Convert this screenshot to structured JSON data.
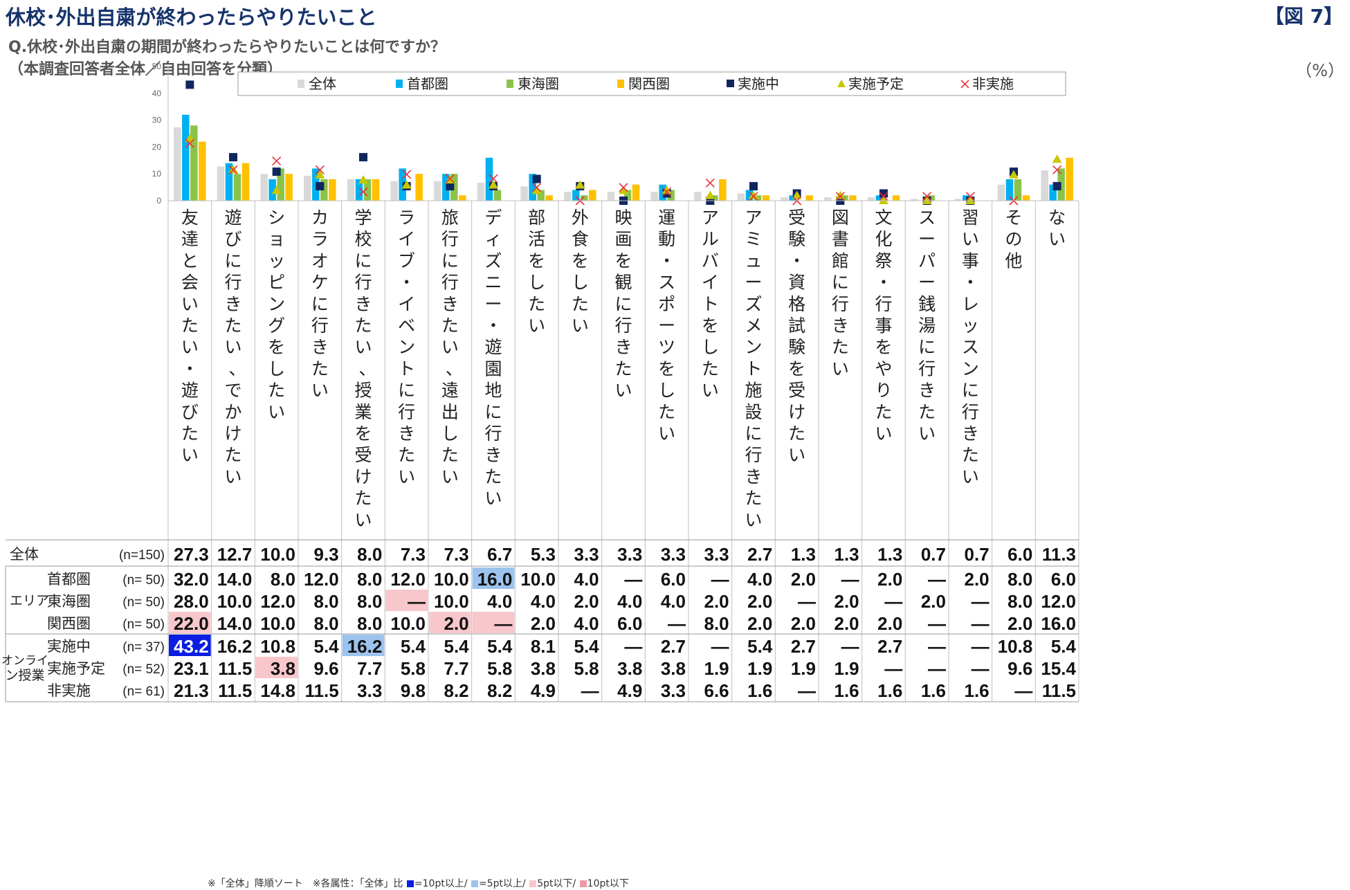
{
  "header": {
    "title": "休校･外出自粛が終わったらやりたいこと",
    "figure_no": "【図 7】",
    "question": "Q.休校･外出自粛の期間が終わったらやりたいことは何ですか？",
    "base": "（本調査回答者全体／自由回答を分類）",
    "unit": "（%）"
  },
  "footnote": {
    "text1": "※「全体」降順ソート　※各属性：「全体」比",
    "text2": "=10pt以上/",
    "text3": "=5pt以上/",
    "text4": "5pt以下/",
    "text5": "10pt以下",
    "colors": {
      "plus10": "#0a1de0",
      "plus5": "#9cc3ee",
      "minus5": "#f7c7cc",
      "minus10": "#ee9aa3"
    }
  },
  "chart_data": {
    "type": "bar",
    "ylim": [
      0,
      50
    ],
    "yticks": [
      0,
      10,
      20,
      30,
      40,
      50
    ],
    "legend_position": "top",
    "categories": [
      "友達と会いたい・遊びたい",
      "遊びに行きたい、でかけたい",
      "ショッピングをしたい",
      "カラオケに行きたい",
      "学校に行きたい、授業を受けたい",
      "ライブ・イベントに行きたい",
      "旅行に行きたい、遠出したい",
      "ディズニー・遊園地に行きたい",
      "部活をしたい",
      "外食をしたい",
      "映画を観に行きたい",
      "運動・スポーツをしたい",
      "アルバイトをしたい",
      "アミューズメント施設に行きたい",
      "受験・資格試験を受けたい",
      "図書館に行きたい",
      "文化祭・行事をやりたい",
      "スーパー銭湯に行きたい",
      "習い事・レッスンに行きたい",
      "その他",
      "ない"
    ],
    "series": [
      {
        "name": "全体",
        "kind": "bar",
        "color": "#d9d9d9",
        "values": [
          27.3,
          12.7,
          10.0,
          9.3,
          8.0,
          7.3,
          7.3,
          6.7,
          5.3,
          3.3,
          3.3,
          3.3,
          3.3,
          2.7,
          1.3,
          1.3,
          1.3,
          0.7,
          0.7,
          6.0,
          11.3
        ]
      },
      {
        "name": "首都圏",
        "kind": "bar",
        "color": "#00b0f0",
        "values": [
          32.0,
          14.0,
          8.0,
          12.0,
          8.0,
          12.0,
          10.0,
          16.0,
          10.0,
          4.0,
          0,
          6.0,
          0,
          4.0,
          2.0,
          0,
          2.0,
          0,
          2.0,
          8.0,
          6.0
        ]
      },
      {
        "name": "東海圏",
        "kind": "bar",
        "color": "#8bc34a",
        "values": [
          28.0,
          10.0,
          12.0,
          8.0,
          8.0,
          0,
          10.0,
          4.0,
          4.0,
          2.0,
          4.0,
          4.0,
          2.0,
          2.0,
          0,
          2.0,
          0,
          2.0,
          0,
          8.0,
          12.0
        ]
      },
      {
        "name": "関西圏",
        "kind": "bar",
        "color": "#ffc000",
        "values": [
          22.0,
          14.0,
          10.0,
          8.0,
          8.0,
          10.0,
          2.0,
          0,
          2.0,
          4.0,
          6.0,
          0,
          8.0,
          2.0,
          2.0,
          2.0,
          2.0,
          0,
          0,
          2.0,
          16.0
        ]
      },
      {
        "name": "実施中",
        "kind": "square",
        "color": "#10265e",
        "values": [
          43.2,
          16.2,
          10.8,
          5.4,
          16.2,
          5.4,
          5.4,
          5.4,
          8.1,
          5.4,
          0,
          2.7,
          0,
          5.4,
          2.7,
          0,
          2.7,
          0,
          0,
          10.8,
          5.4
        ]
      },
      {
        "name": "実施予定",
        "kind": "triangle",
        "color": "#c8c800",
        "values": [
          23.1,
          11.5,
          3.8,
          9.6,
          7.7,
          5.8,
          7.7,
          5.8,
          3.8,
          5.8,
          3.8,
          3.8,
          1.9,
          1.9,
          1.9,
          1.9,
          0,
          0,
          0,
          9.6,
          15.4
        ]
      },
      {
        "name": "非実施",
        "kind": "cross",
        "color": "#e8303a",
        "values": [
          21.3,
          11.5,
          14.8,
          11.5,
          3.3,
          9.8,
          8.2,
          8.2,
          4.9,
          0,
          4.9,
          3.3,
          6.6,
          1.6,
          0,
          1.6,
          1.6,
          1.6,
          1.6,
          0,
          11.5
        ]
      }
    ],
    "table": {
      "groups": [
        {
          "label": "",
          "rows": [
            0
          ]
        },
        {
          "label": "エリア",
          "rows": [
            1,
            2,
            3
          ]
        },
        {
          "label": "オンライン授業",
          "rows": [
            4,
            5,
            6
          ]
        }
      ],
      "rows": [
        {
          "label": "全体",
          "n": "(n=150)",
          "cells": [
            "27.3",
            "12.7",
            "10.0",
            "9.3",
            "8.0",
            "7.3",
            "7.3",
            "6.7",
            "5.3",
            "3.3",
            "3.3",
            "3.3",
            "3.3",
            "2.7",
            "1.3",
            "1.3",
            "1.3",
            "0.7",
            "0.7",
            "6.0",
            "11.3"
          ],
          "hl": {}
        },
        {
          "label": "首都圏",
          "n": "(n=  50)",
          "cells": [
            "32.0",
            "14.0",
            "8.0",
            "12.0",
            "8.0",
            "12.0",
            "10.0",
            "16.0",
            "10.0",
            "4.0",
            "—",
            "6.0",
            "—",
            "4.0",
            "2.0",
            "—",
            "2.0",
            "—",
            "2.0",
            "8.0",
            "6.0"
          ],
          "hl": {
            "7": "plus5"
          }
        },
        {
          "label": "東海圏",
          "n": "(n=  50)",
          "cells": [
            "28.0",
            "10.0",
            "12.0",
            "8.0",
            "8.0",
            "—",
            "10.0",
            "4.0",
            "4.0",
            "2.0",
            "4.0",
            "4.0",
            "2.0",
            "2.0",
            "—",
            "2.0",
            "—",
            "2.0",
            "—",
            "8.0",
            "12.0"
          ],
          "hl": {
            "5": "minus5"
          }
        },
        {
          "label": "関西圏",
          "n": "(n=  50)",
          "cells": [
            "22.0",
            "14.0",
            "10.0",
            "8.0",
            "8.0",
            "10.0",
            "2.0",
            "—",
            "2.0",
            "4.0",
            "6.0",
            "—",
            "8.0",
            "2.0",
            "2.0",
            "2.0",
            "2.0",
            "—",
            "—",
            "2.0",
            "16.0"
          ],
          "hl": {
            "0": "minus5",
            "6": "minus5",
            "7": "minus5"
          }
        },
        {
          "label": "実施中",
          "n": "(n=  37)",
          "cells": [
            "43.2",
            "16.2",
            "10.8",
            "5.4",
            "16.2",
            "5.4",
            "5.4",
            "5.4",
            "8.1",
            "5.4",
            "—",
            "2.7",
            "—",
            "5.4",
            "2.7",
            "—",
            "2.7",
            "—",
            "—",
            "10.8",
            "5.4"
          ],
          "hl": {
            "0": "plus10",
            "4": "plus5"
          }
        },
        {
          "label": "実施予定",
          "n": "(n=  52)",
          "cells": [
            "23.1",
            "11.5",
            "3.8",
            "9.6",
            "7.7",
            "5.8",
            "7.7",
            "5.8",
            "3.8",
            "5.8",
            "3.8",
            "3.8",
            "1.9",
            "1.9",
            "1.9",
            "1.9",
            "—",
            "—",
            "—",
            "9.6",
            "15.4"
          ],
          "hl": {
            "2": "minus5"
          }
        },
        {
          "label": "非実施",
          "n": "(n=  61)",
          "cells": [
            "21.3",
            "11.5",
            "14.8",
            "11.5",
            "3.3",
            "9.8",
            "8.2",
            "8.2",
            "4.9",
            "—",
            "4.9",
            "3.3",
            "6.6",
            "1.6",
            "—",
            "1.6",
            "1.6",
            "1.6",
            "1.6",
            "—",
            "11.5"
          ],
          "hl": {}
        }
      ]
    }
  }
}
